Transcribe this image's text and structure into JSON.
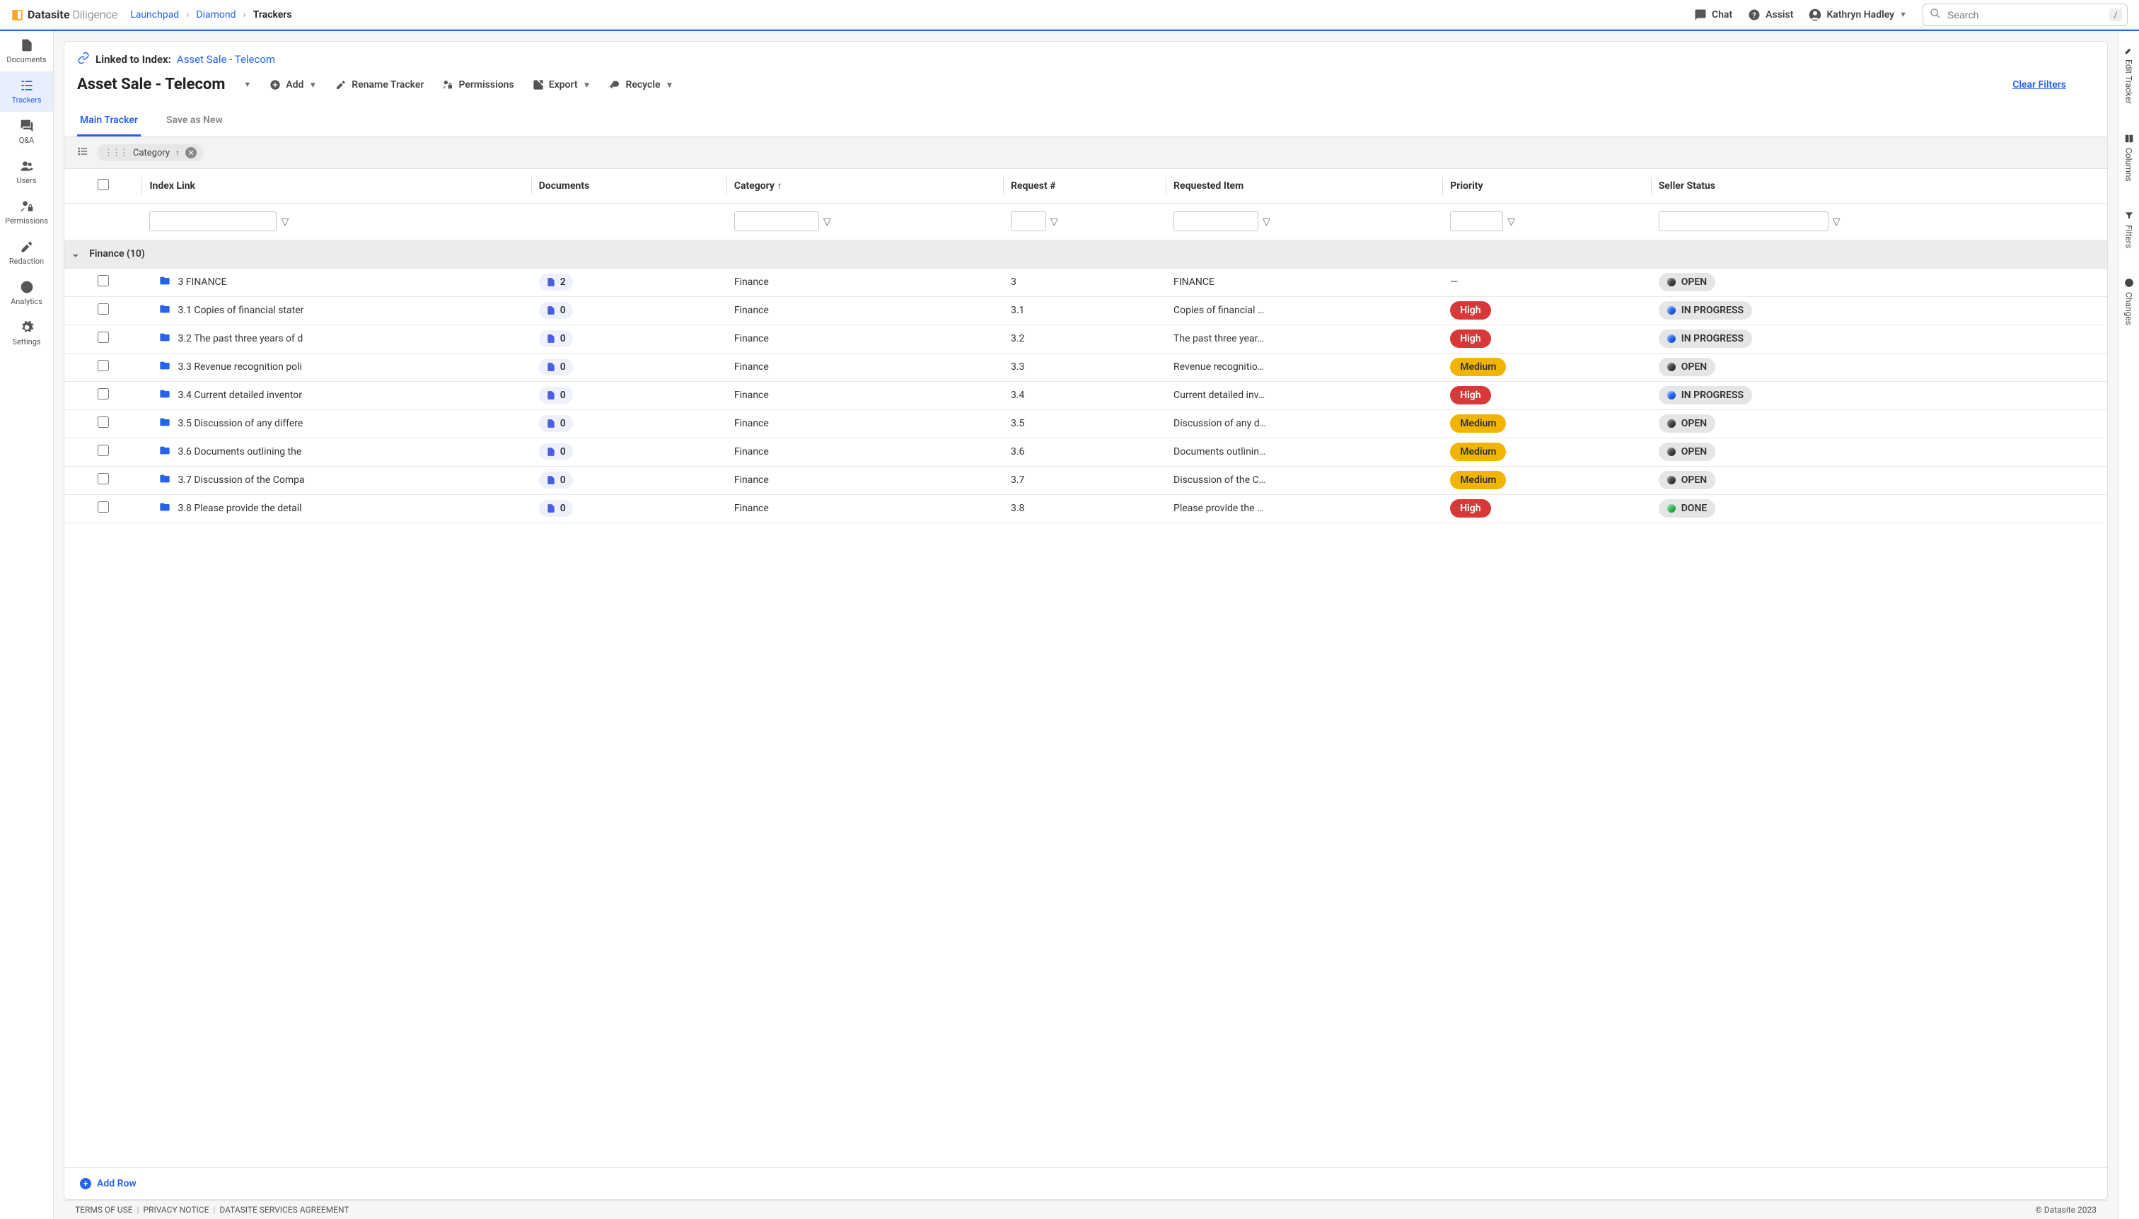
{
  "brand": {
    "bold": "Datasite",
    "light": "Diligence"
  },
  "breadcrumb": {
    "launchpad": "Launchpad",
    "project": "Diamond",
    "current": "Trackers"
  },
  "header": {
    "chat": "Chat",
    "assist": "Assist",
    "user": "Kathryn Hadley",
    "search_placeholder": "Search",
    "slash": "/"
  },
  "sidebar": {
    "documents": "Documents",
    "trackers": "Trackers",
    "qa": "Q&A",
    "users": "Users",
    "permissions": "Permissions",
    "redaction": "Redaction",
    "analytics": "Analytics",
    "settings": "Settings"
  },
  "linked": {
    "label": "Linked to Index:",
    "target": "Asset Sale - Telecom"
  },
  "tracker": {
    "title": "Asset Sale - Telecom",
    "add": "Add",
    "rename": "Rename Tracker",
    "permissions": "Permissions",
    "export": "Export",
    "recycle": "Recycle",
    "clear_filters": "Clear Filters"
  },
  "tabs": {
    "main": "Main Tracker",
    "save": "Save as New"
  },
  "group_chip": "Category",
  "columns": {
    "index_link": "Index Link",
    "documents": "Documents",
    "category": "Category",
    "request_no": "Request #",
    "requested_item": "Requested Item",
    "priority": "Priority",
    "seller_status": "Seller Status"
  },
  "group": {
    "name": "Finance",
    "count": "(10)"
  },
  "rows": [
    {
      "index": "3 FINANCE",
      "docs": "2",
      "category": "Finance",
      "req": "3",
      "item": "FINANCE",
      "priority": "—",
      "priority_class": "none",
      "status": "OPEN",
      "status_dot": "black"
    },
    {
      "index": "3.1 Copies of financial stater",
      "docs": "0",
      "category": "Finance",
      "req": "3.1",
      "item": "Copies of financial …",
      "priority": "High",
      "priority_class": "high",
      "status": "IN PROGRESS",
      "status_dot": "blue"
    },
    {
      "index": "3.2 The past three years of d",
      "docs": "0",
      "category": "Finance",
      "req": "3.2",
      "item": "The past three year…",
      "priority": "High",
      "priority_class": "high",
      "status": "IN PROGRESS",
      "status_dot": "blue"
    },
    {
      "index": "3.3 Revenue recognition poli",
      "docs": "0",
      "category": "Finance",
      "req": "3.3",
      "item": "Revenue recognitio…",
      "priority": "Medium",
      "priority_class": "medium",
      "status": "OPEN",
      "status_dot": "black"
    },
    {
      "index": "3.4 Current detailed inventor",
      "docs": "0",
      "category": "Finance",
      "req": "3.4",
      "item": "Current detailed inv…",
      "priority": "High",
      "priority_class": "high",
      "status": "IN PROGRESS",
      "status_dot": "blue"
    },
    {
      "index": "3.5 Discussion of any differe",
      "docs": "0",
      "category": "Finance",
      "req": "3.5",
      "item": "Discussion of any d…",
      "priority": "Medium",
      "priority_class": "medium",
      "status": "OPEN",
      "status_dot": "black"
    },
    {
      "index": "3.6 Documents outlining the",
      "docs": "0",
      "category": "Finance",
      "req": "3.6",
      "item": "Documents outlinin…",
      "priority": "Medium",
      "priority_class": "medium",
      "status": "OPEN",
      "status_dot": "black"
    },
    {
      "index": "3.7 Discussion of the Compa",
      "docs": "0",
      "category": "Finance",
      "req": "3.7",
      "item": "Discussion of the C…",
      "priority": "Medium",
      "priority_class": "medium",
      "status": "OPEN",
      "status_dot": "black"
    },
    {
      "index": "3.8 Please provide the detail",
      "docs": "0",
      "category": "Finance",
      "req": "3.8",
      "item": "Please provide the …",
      "priority": "High",
      "priority_class": "high",
      "status": "DONE",
      "status_dot": "green"
    }
  ],
  "add_row": "Add Row",
  "rail": {
    "edit": "Edit Tracker",
    "columns": "Columns",
    "filters": "Filters",
    "changes": "Changes"
  },
  "footer": {
    "terms": "TERMS OF USE",
    "privacy": "PRIVACY NOTICE",
    "dsa": "DATASITE SERVICES AGREEMENT",
    "copy": "© Datasite 2023"
  }
}
